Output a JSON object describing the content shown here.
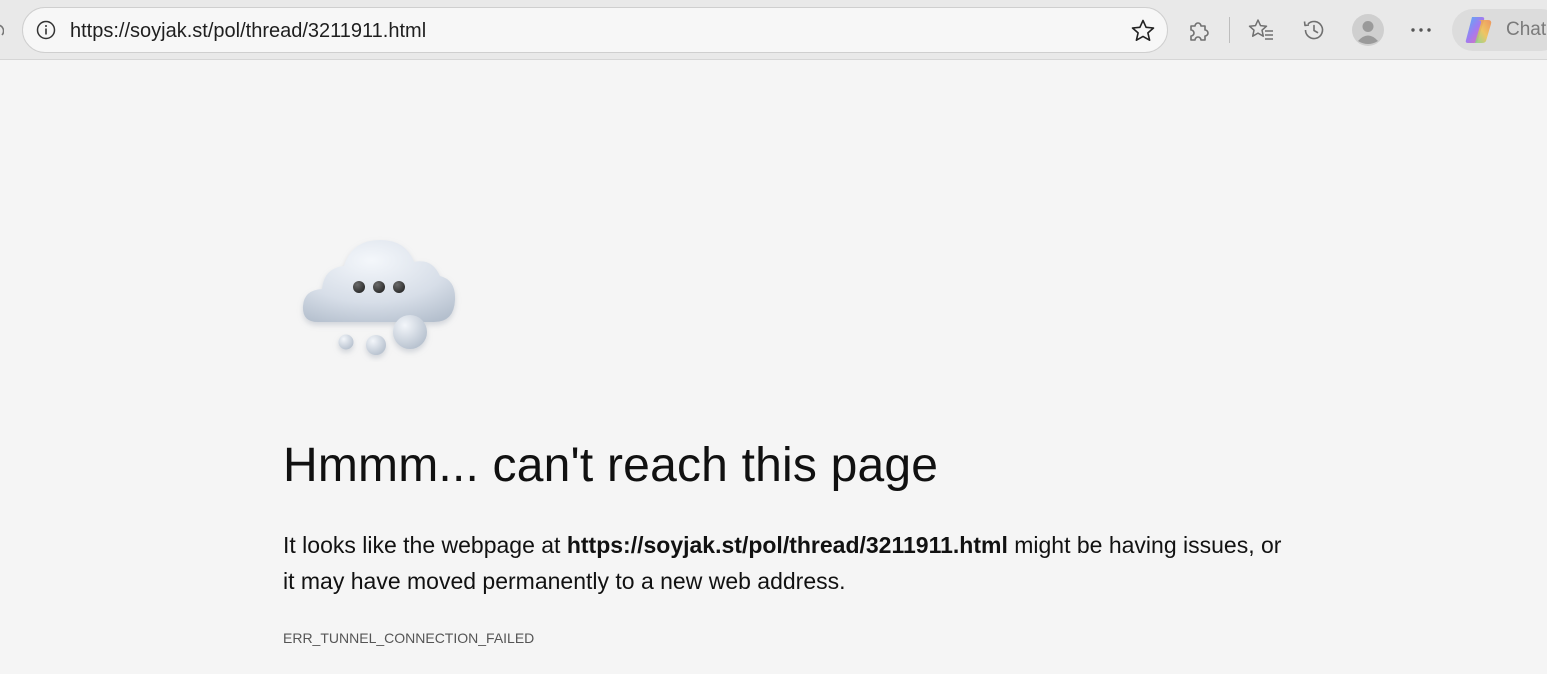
{
  "browser": {
    "address_bar": {
      "url": "https://soyjak.st/pol/thread/3211911.html"
    },
    "toolbar": {
      "chat_label": "Chat",
      "icons": [
        "site-info-icon",
        "favorite-star-icon",
        "extensions-icon",
        "favorites-icon",
        "history-icon",
        "profile-avatar-icon",
        "more-options-icon",
        "copilot-icon"
      ]
    }
  },
  "error_page": {
    "illustration": "thinking-cloud-icon",
    "heading": "Hmmm... can't reach this page",
    "description_prefix": "It looks like the webpage at ",
    "description_url": "https://soyjak.st/pol/thread/3211911.html",
    "description_suffix": " might be having issues, or it may have moved permanently to a new web address.",
    "error_code": "ERR_TUNNEL_CONNECTION_FAILED"
  },
  "colors": {
    "page_background": "#f5f5f5",
    "toolbar_background": "#e9e9e9",
    "text": "#111111"
  }
}
